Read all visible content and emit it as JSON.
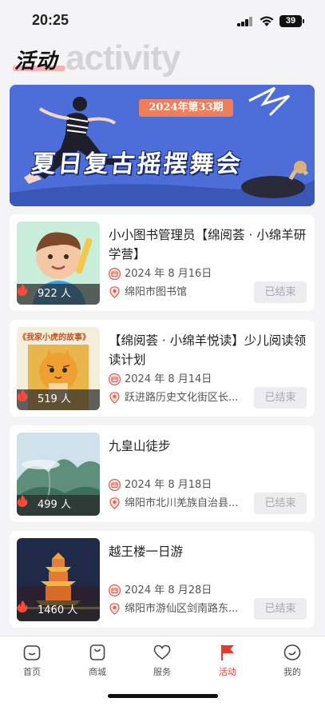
{
  "status_bar": {
    "time": "20:25",
    "battery": "39"
  },
  "header": {
    "title": "活动",
    "subtitle": "activity"
  },
  "banner": {
    "issue": "2024年第33期",
    "title": "夏日复古摇摆舞会"
  },
  "activities": [
    {
      "title": "小小图书管理员【绵阅荟 · 小绵羊研学营】",
      "date": "2024 年 8 月16日",
      "location": "绵阳市图书馆",
      "participants": "922 人",
      "status": "已结束",
      "thumb_caption": ""
    },
    {
      "title": "【绵阅荟 · 小绵羊悦读】少儿阅读领读计划",
      "date": "2024 年 8 月14日",
      "location": "跃进路历史文化街区长...",
      "participants": "519 人",
      "status": "已结束",
      "thumb_caption": "《我家小虎的故事》"
    },
    {
      "title": "九皇山徒步",
      "date": "2024 年 8 月18日",
      "location": "绵阳市北川羌族自治县...",
      "participants": "499 人",
      "status": "已结束",
      "thumb_caption": ""
    },
    {
      "title": "越王楼一日游",
      "date": "2024 年 8 月28日",
      "location": "绵阳市游仙区剑南路东...",
      "participants": "1460 人",
      "status": "已结束",
      "thumb_caption": ""
    }
  ],
  "tabs": [
    {
      "label": "首页",
      "icon": "home-icon",
      "active": false
    },
    {
      "label": "商城",
      "icon": "shop-bag-icon",
      "active": false
    },
    {
      "label": "服务",
      "icon": "heart-icon",
      "active": false
    },
    {
      "label": "活动",
      "icon": "flag-icon",
      "active": true
    },
    {
      "label": "我的",
      "icon": "smile-icon",
      "active": false
    }
  ],
  "colors": {
    "accent": "#e23b2e",
    "banner_bg": "#4d6ed8",
    "issue_tag": "#ef7f5b"
  }
}
